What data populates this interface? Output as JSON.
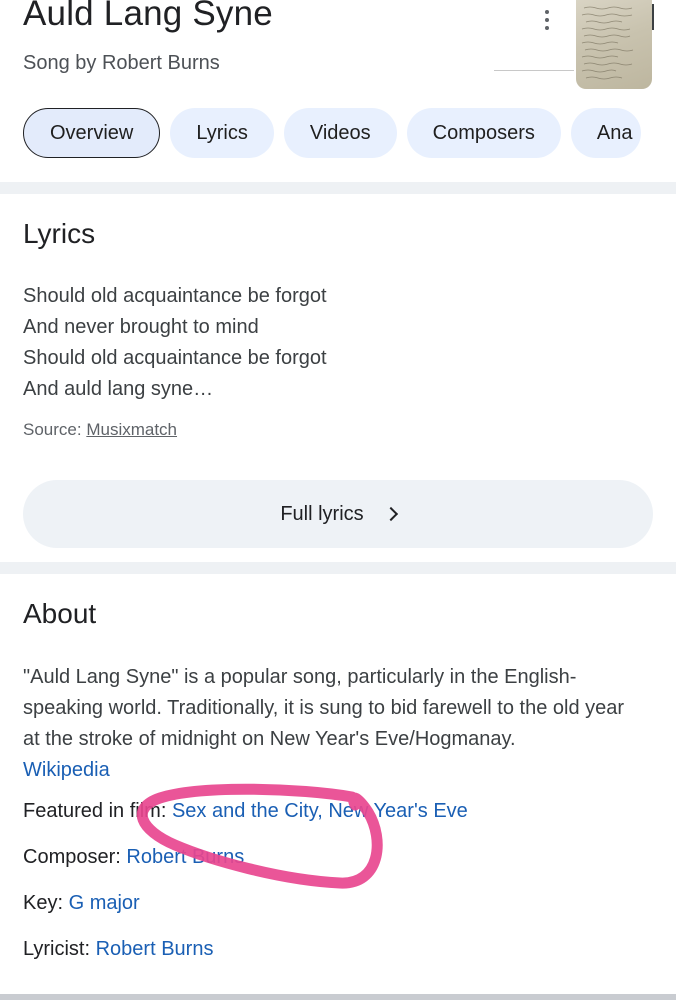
{
  "header": {
    "title": "Auld Lang Syne",
    "subtitle": "Song by Robert Burns"
  },
  "tabs": [
    {
      "label": "Overview",
      "active": true
    },
    {
      "label": "Lyrics",
      "active": false
    },
    {
      "label": "Videos",
      "active": false
    },
    {
      "label": "Composers",
      "active": false
    },
    {
      "label": "Ana",
      "active": false
    }
  ],
  "lyrics": {
    "title": "Lyrics",
    "lines": [
      "Should old acquaintance be forgot",
      "And never brought to mind",
      "Should old acquaintance be forgot",
      "And auld lang syne…"
    ],
    "source_label": "Source:",
    "source_name": "Musixmatch",
    "full_lyrics_button": "Full lyrics"
  },
  "about": {
    "title": "About",
    "description": "\"Auld Lang Syne\" is a popular song, particularly in the English-speaking world. Traditionally, it is sung to bid farewell to the old year at the stroke of midnight on New Year's Eve/Hogmanay.",
    "wikipedia_link": "Wikipedia",
    "facts": {
      "film_label": "Featured in film:",
      "film_1": "Sex and the City",
      "film_separator": ",",
      "film_2": "New Year's Eve",
      "composer_label": "Composer:",
      "composer_value": "Robert Burns",
      "key_label": "Key:",
      "key_value": "G major",
      "lyricist_label": "Lyricist:",
      "lyricist_value": "Robert Burns"
    }
  },
  "icons": {
    "more": "more-vert-icon",
    "chevron": "chevron-right-icon"
  },
  "colors": {
    "link": "#1a5fb4",
    "chip_bg": "#e8f0fe",
    "annotation": "#e8468f"
  }
}
